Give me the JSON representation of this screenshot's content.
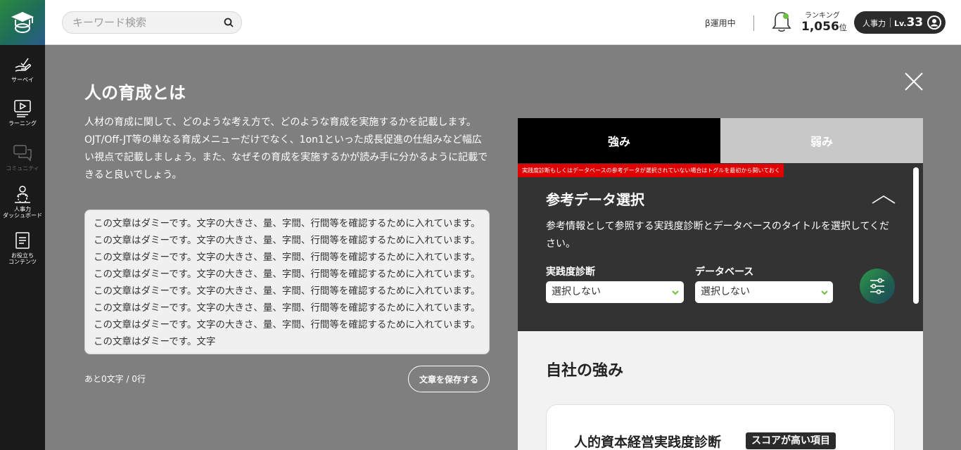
{
  "header": {
    "search_placeholder": "キーワード検索",
    "beta_label": "β運用中",
    "ranking_label": "ランキング",
    "ranking_value": "1,056",
    "ranking_unit": "位",
    "level_label": "人事力",
    "level_prefix": "Lv.",
    "level_value": "33"
  },
  "sidebar": {
    "items": [
      {
        "label": "サーベイ",
        "icon": "survey-hand-icon"
      },
      {
        "label": "ラーニング",
        "icon": "learning-monitor-icon"
      },
      {
        "label": "コミュニティ",
        "icon": "community-chat-icon"
      },
      {
        "label_line1": "人事力",
        "label_line2": "ダッシュボード",
        "icon": "dashboard-person-icon"
      },
      {
        "label_line1": "お役立ち",
        "label_line2": "コンテンツ",
        "icon": "document-icon"
      }
    ]
  },
  "main": {
    "title": "人の育成とは",
    "description": "人材の育成に関して、どのような考え方で、どのような育成を実施するかを記載します。OJT/Off-JT等の単なる育成メニューだけでなく、1on1といった成長促進の仕組みなど幅広い視点で記載しましょう。また、なぜその育成を実施するかが読み手に分かるように記載できると良いでしょう。",
    "textarea_value": "この文章はダミーです。文字の大きさ、量、字間、行間等を確認するために入れています。この文章はダミーです。文字の大きさ、量、字間、行間等を確認するために入れています。この文章はダミーです。文字の大きさ、量、字間、行間等を確認するために入れています。この文章はダミーです。文字の大きさ、量、字間、行間等を確認するために入れています。この文章はダミーです。文字の大きさ、量、字間、行間等を確認するために入れています。この文章はダミーです。文字の大きさ、量、字間、行間等を確認するために入れています。この文章はダミーです。文字の大きさ、量、字間、行間等を確認するために入れています。この文章はダミーです。文字",
    "counter": "あと0文字 / 0行",
    "save_label": "文章を保存する"
  },
  "panel": {
    "tabs": [
      {
        "label": "強み",
        "active": true
      },
      {
        "label": "弱み",
        "active": false
      }
    ],
    "warning": "実践度診断もしくはデータベースの参考データが選択されていない場合はトグルを最初から開いておく",
    "ref_title": "参考データ選択",
    "ref_desc": "参考情報として参照する実践度診断とデータベースのタイトルを選択してください。",
    "selects": [
      {
        "label": "実践度診断",
        "value": "選択しない"
      },
      {
        "label": "データベース",
        "value": "選択しない"
      }
    ],
    "strength_title": "自社の強み",
    "card_title": "人的資本経営実践度診断",
    "card_badge": "スコアが高い項目"
  },
  "colors": {
    "accent_green": "#6dbf3e",
    "warning_red": "#e00000",
    "dark_panel": "#333333",
    "overlay": "#7f7f7f"
  }
}
